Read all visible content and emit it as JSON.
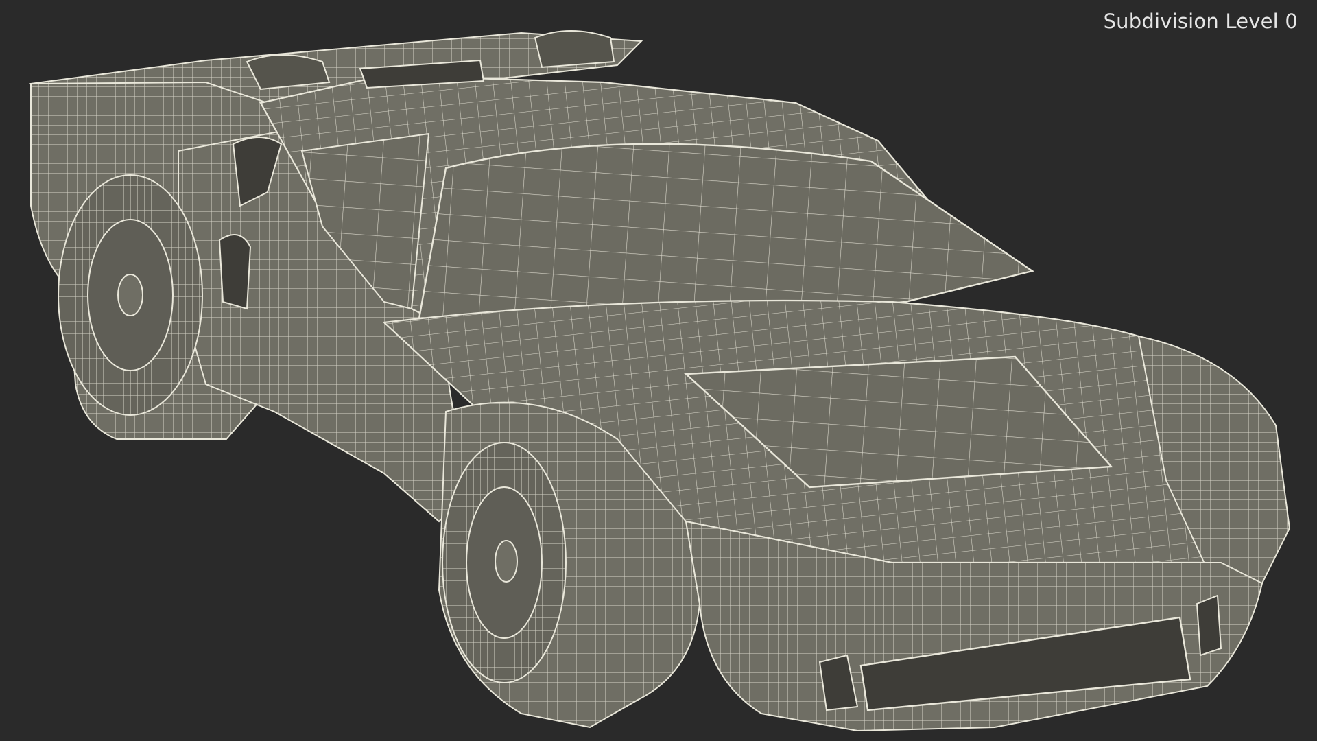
{
  "viewport": {
    "overlay_label": "Subdivision Level 0"
  },
  "render": {
    "subject": "car-wireframe-render",
    "colors": {
      "background": "#2a2a2a",
      "surface": "#6f6e64",
      "surface_dark": "#55544c",
      "wire": "#e9e7da",
      "cavity": "#3e3d38"
    }
  }
}
